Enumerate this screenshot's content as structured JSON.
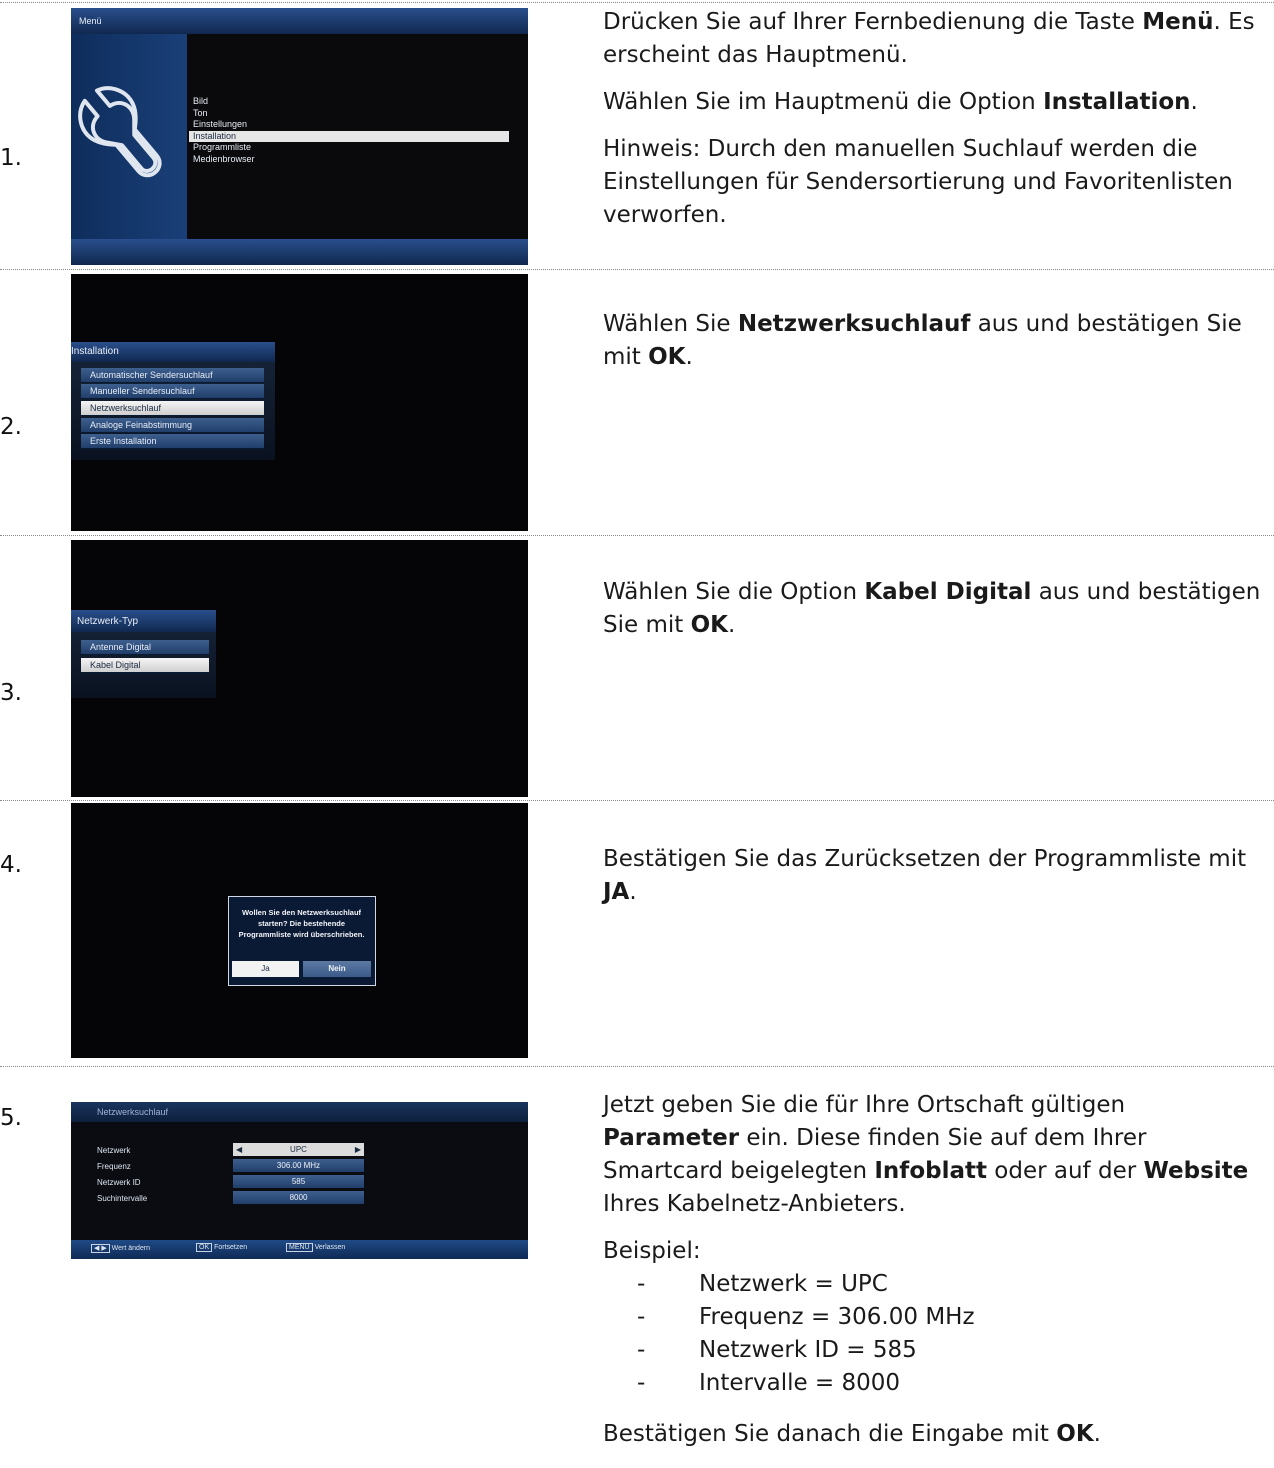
{
  "steps": [
    {
      "number": "1.",
      "screen": {
        "title": "Menü",
        "items": [
          "Bild",
          "Ton",
          "Einstellungen",
          "Installation",
          "Programmliste",
          "Medienbrowser"
        ],
        "selected": "Installation",
        "icon": "wrench-icon"
      },
      "paragraphs": [
        [
          "Drücken Sie auf Ihrer Fernbedienung die Taste ",
          "Menü",
          ". Es erscheint das Hauptmenü."
        ],
        [
          "Wählen Sie im Hauptmenü die Option ",
          "Installation",
          "."
        ],
        [
          "Hinweis: Durch den manuellen Suchlauf werden die Einstellungen für Sendersortierung und Favoritenlisten verworfen."
        ]
      ]
    },
    {
      "number": "2.",
      "screen": {
        "title": "Installation",
        "items": [
          "Automatischer Sendersuchlauf",
          "Manueller Sendersuchlauf",
          "Netzwerksuchlauf",
          "Analoge Feinabstimmung",
          "Erste Installation"
        ],
        "selected": "Netzwerksuchlauf"
      },
      "paragraphs": [
        [
          "Wählen Sie ",
          "Netzwerksuchlauf",
          " aus und bestätigen Sie mit ",
          "OK",
          "."
        ]
      ]
    },
    {
      "number": "3.",
      "screen": {
        "title": "Netzwerk-Typ",
        "items": [
          "Antenne Digital",
          "Kabel Digital"
        ],
        "selected": "Kabel Digital"
      },
      "paragraphs": [
        [
          "Wählen Sie die Option ",
          "Kabel Digital",
          " aus und bestätigen Sie mit ",
          "OK",
          "."
        ]
      ]
    },
    {
      "number": "4.",
      "screen": {
        "dialog_lines": [
          "Wollen Sie den Netzwerksuchlauf",
          "starten? Die bestehende",
          "Programmliste wird überschrieben."
        ],
        "yes": "Ja",
        "no": "Nein"
      },
      "paragraphs": [
        [
          "Bestätigen Sie das Zurücksetzen der Programmliste mit ",
          "JA",
          "."
        ]
      ]
    },
    {
      "number": "5.",
      "screen": {
        "title": "Netzwerksuchlauf",
        "rows": [
          {
            "label": "Netzwerk",
            "value": "UPC"
          },
          {
            "label": "Frequenz",
            "value": "306.00 MHz"
          },
          {
            "label": "Netzwerk ID",
            "value": "585"
          },
          {
            "label": "Suchintervalle",
            "value": "8000"
          }
        ],
        "footer": [
          {
            "key": "◀ ▶",
            "label": "Wert ändern"
          },
          {
            "key": "OK",
            "label": "Fortsetzen"
          },
          {
            "key": "MENU",
            "label": "Verlassen"
          }
        ]
      },
      "paragraphs": [
        [
          "Jetzt geben Sie die für Ihre Ortschaft gültigen ",
          "Parameter",
          " ein. Diese finden Sie auf dem Ihrer Smartcard beigelegten ",
          "Infoblatt",
          " oder auf der ",
          "Website",
          " Ihres Kabelnetz-Anbieters."
        ],
        [
          "Beispiel:"
        ]
      ],
      "example": [
        "Netzwerk = UPC",
        "Frequenz = 306.00 MHz",
        "Netzwerk ID = 585",
        "Intervalle = 8000"
      ],
      "closing": [
        "Bestätigen Sie danach die Eingabe mit ",
        "OK",
        "."
      ]
    }
  ]
}
